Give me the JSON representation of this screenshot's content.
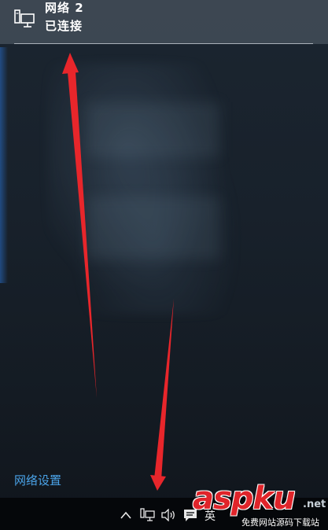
{
  "network": {
    "name": "网络 2",
    "status": "已连接",
    "icon": "wired-network-icon"
  },
  "settings_link": "网络设置",
  "taskbar": {
    "ime_label": "英",
    "tray_icons": [
      "chevron-up-icon",
      "network-icon",
      "volume-icon",
      "action-center-icon"
    ]
  },
  "watermark": {
    "logo": "aspku",
    "suffix": ".net",
    "subtitle": "免费网站源码下载站"
  },
  "colors": {
    "link": "#4aa3e8",
    "arrow": "#e8262b",
    "taskbar": "#05070a"
  }
}
